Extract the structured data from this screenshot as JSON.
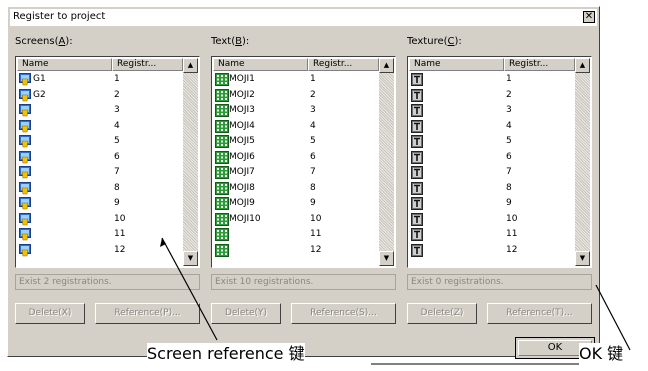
{
  "dialog": {
    "title": "Register to project",
    "close_glyph": "✕"
  },
  "columns": {
    "name": "Name",
    "registr": "Registr..."
  },
  "scroll": {
    "up_glyph": "▲",
    "down_glyph": "▼"
  },
  "panels": [
    {
      "label_pre": "Screens(",
      "accel": "A",
      "label_post": "):",
      "icon": "screen-icon",
      "names": [
        "G1",
        "G2",
        "",
        "",
        "",
        "",
        "",
        "",
        "",
        "",
        "",
        ""
      ],
      "numbers": [
        "1",
        "2",
        "3",
        "4",
        "5",
        "6",
        "7",
        "8",
        "9",
        "10",
        "11",
        "12"
      ],
      "status": "Exist 2 registrations.",
      "delete_label": "Delete(X)",
      "reference_label": "Reference(P)..."
    },
    {
      "label_pre": "Text(",
      "accel": "B",
      "label_post": "):",
      "icon": "text-grid-icon",
      "names": [
        "MOJI1",
        "MOJI2",
        "MOJI3",
        "MOJI4",
        "MOJI5",
        "MOJI6",
        "MOJI7",
        "MOJI8",
        "MOJI9",
        "MOJI10",
        "",
        ""
      ],
      "numbers": [
        "1",
        "2",
        "3",
        "4",
        "5",
        "6",
        "7",
        "8",
        "9",
        "10",
        "11",
        "12"
      ],
      "status": "Exist 10 registrations.",
      "delete_label": "Delete(Y)",
      "reference_label": "Reference(S)..."
    },
    {
      "label_pre": "Texture(",
      "accel": "C",
      "label_post": "):",
      "icon": "texture-icon",
      "names": [
        "",
        "",
        "",
        "",
        "",
        "",
        "",
        "",
        "",
        "",
        "",
        ""
      ],
      "numbers": [
        "1",
        "2",
        "3",
        "4",
        "5",
        "6",
        "7",
        "8",
        "9",
        "10",
        "11",
        "12"
      ],
      "status": "Exist 0 registrations.",
      "delete_label": "Delete(Z)",
      "reference_label": "Reference(T)..."
    }
  ],
  "ok_label": "OK",
  "annotations": {
    "screen_reference": "Screen reference 键",
    "ok": "OK 键"
  }
}
